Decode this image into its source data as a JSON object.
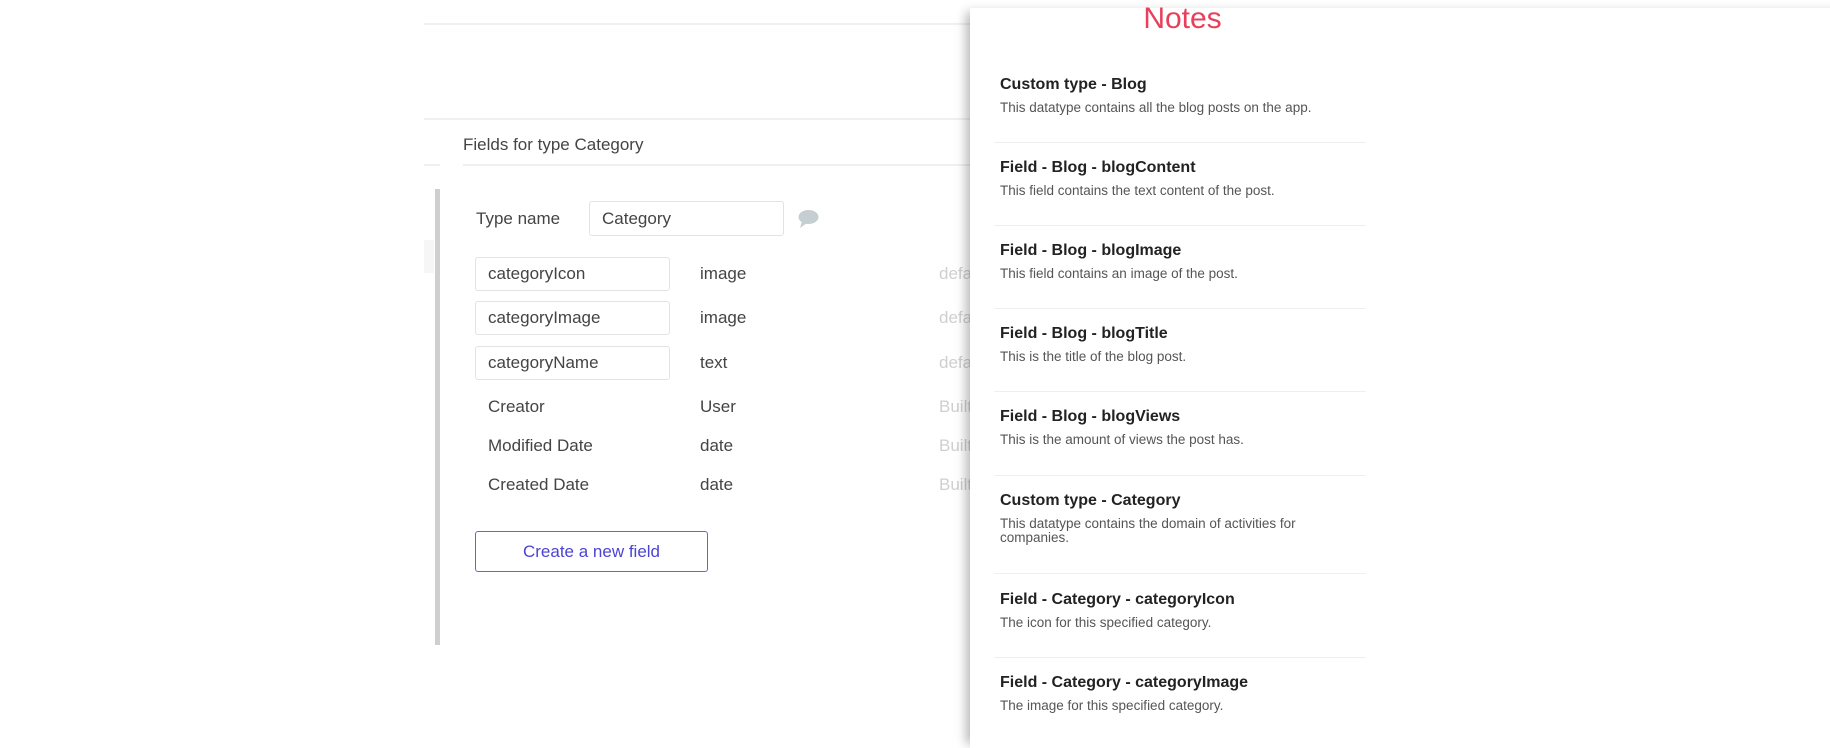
{
  "editor": {
    "section_title": "Fields for type Category",
    "type_name_label": "Type name",
    "type_name_value": "Category",
    "comment_icon": "speech-bubble-icon",
    "custom_fields": [
      {
        "name": "categoryIcon",
        "type": "image",
        "extra": "defa"
      },
      {
        "name": "categoryImage",
        "type": "image",
        "extra": "defa"
      },
      {
        "name": "categoryName",
        "type": "text",
        "extra": "defa"
      }
    ],
    "builtin_fields": [
      {
        "name": "Creator",
        "type": "User",
        "extra": "Built"
      },
      {
        "name": "Modified Date",
        "type": "date",
        "extra": "Built"
      },
      {
        "name": "Created Date",
        "type": "date",
        "extra": "Built"
      }
    ],
    "create_button_label": "Create a new field",
    "accent_color": "#4b43d4"
  },
  "notes": {
    "title": "Notes",
    "title_color": "#e8405a",
    "items": [
      {
        "title": "Custom type - Blog",
        "description": "This datatype contains all the blog posts on the app."
      },
      {
        "title": "Field - Blog - blogContent",
        "description": "This field contains the text content of the post."
      },
      {
        "title": "Field - Blog - blogImage",
        "description": "This field contains an image of the post."
      },
      {
        "title": "Field - Blog - blogTitle",
        "description": "This is the title of the blog post."
      },
      {
        "title": "Field - Blog - blogViews",
        "description": "This is the amount of views the post has."
      },
      {
        "title": "Custom type - Category",
        "description": "This datatype contains the domain of activities for companies."
      },
      {
        "title": "Field - Category - categoryIcon",
        "description": "The icon for this specified category."
      },
      {
        "title": "Field - Category - categoryImage",
        "description": "The image for this specified category."
      }
    ]
  }
}
